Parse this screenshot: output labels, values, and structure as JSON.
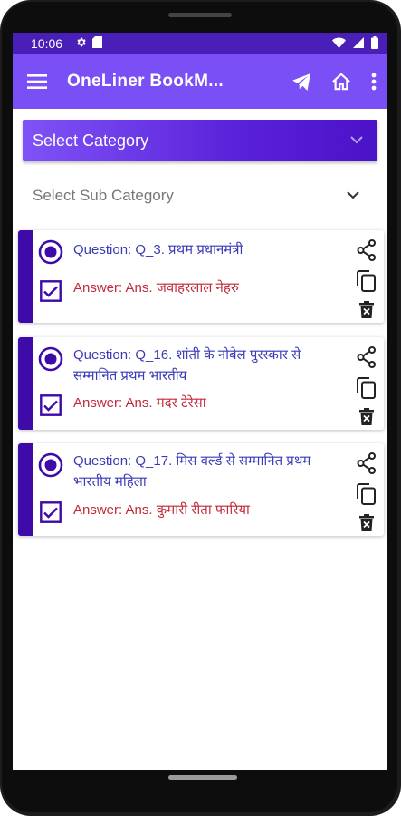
{
  "status": {
    "time": "10:06"
  },
  "appbar": {
    "title": "OneLiner BookM..."
  },
  "category": {
    "label": "Select Category"
  },
  "subcategory": {
    "label": "Select Sub Category"
  },
  "cards": [
    {
      "question": "Question: Q_3. प्रथम प्रधानमंत्री",
      "answer": "Answer: Ans. जवाहरलाल नेहरु"
    },
    {
      "question": "Question: Q_16. शांती के नोबेल पुरस्कार से सम्मानित प्रथम भारतीय",
      "answer": "Answer: Ans. मदर टेरेसा"
    },
    {
      "question": "Question: Q_17. मिस वर्ल्ड से सम्मानित प्रथम भारतीय महिला",
      "answer": "Answer: Ans. कुमारी रीता फारिया"
    }
  ],
  "colors": {
    "status_bar": "#4a1fb8",
    "app_bar": "#7a4ff5",
    "card_stripe": "#3e0aa8",
    "question_text": "#3b3bb8",
    "answer_text": "#c02a3a"
  },
  "icons": [
    "settings-icon",
    "sim-icon",
    "wifi-icon",
    "signal-icon",
    "battery-icon",
    "menu-icon",
    "send-icon",
    "home-icon",
    "more-vert-icon",
    "chevron-down-icon",
    "radio-selected-icon",
    "checkbox-checked-icon",
    "share-icon",
    "copy-icon",
    "delete-icon"
  ]
}
